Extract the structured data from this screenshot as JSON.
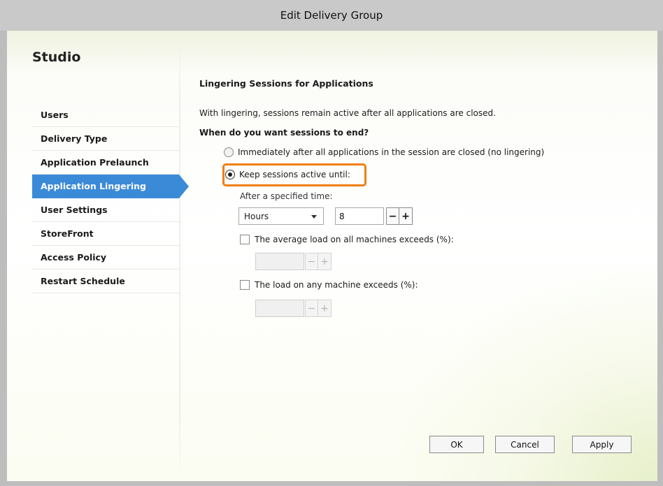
{
  "window": {
    "title": "Edit Delivery Group"
  },
  "sidebar": {
    "brand": "Studio",
    "items": [
      {
        "label": "Users"
      },
      {
        "label": "Delivery Type"
      },
      {
        "label": "Application Prelaunch"
      },
      {
        "label": "Application Lingering",
        "active": true
      },
      {
        "label": "User Settings"
      },
      {
        "label": "StoreFront"
      },
      {
        "label": "Access Policy"
      },
      {
        "label": "Restart Schedule"
      }
    ]
  },
  "main": {
    "heading": "Lingering Sessions for Applications",
    "description": "With lingering, sessions remain active after all applications are closed.",
    "question": "When do you want sessions to end?",
    "options": {
      "immediate": {
        "label": "Immediately after all applications in the session are closed (no lingering)",
        "checked": false
      },
      "keep_active": {
        "label": "Keep sessions active until:",
        "checked": true
      }
    },
    "specified_time": {
      "label": "After a specified time:",
      "unit_selected": "Hours",
      "value": "8",
      "minus": "−",
      "plus": "+"
    },
    "average_load": {
      "label": "The average load on all machines exceeds (%):",
      "checked": false,
      "value": "",
      "minus": "−",
      "plus": "+"
    },
    "any_machine_load": {
      "label": "The load on any machine exceeds (%):",
      "checked": false,
      "value": "",
      "minus": "−",
      "plus": "+"
    }
  },
  "footer": {
    "ok_label": "OK",
    "cancel_label": "Cancel",
    "apply_label": "Apply"
  },
  "colors": {
    "accent": "#3b8ad8",
    "highlight": "#f07f12"
  }
}
